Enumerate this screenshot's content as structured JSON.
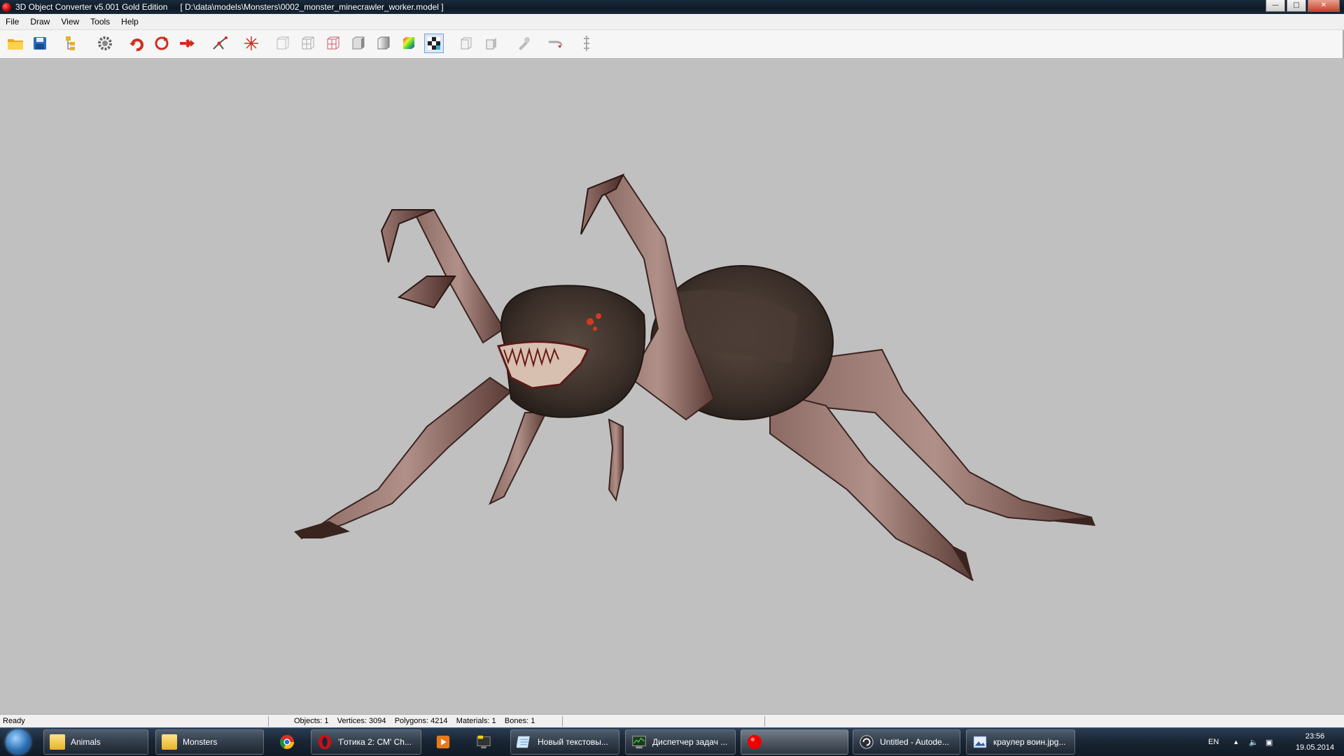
{
  "window": {
    "title": "3D Object Converter v5.001 Gold Edition",
    "path": "[ D:\\data\\models\\Monsters\\0002_monster_minecrawler_worker.model ]",
    "buttons": [
      "minimize",
      "maximize",
      "close"
    ]
  },
  "menu": [
    "File",
    "Draw",
    "View",
    "Tools",
    "Help"
  ],
  "toolbar": {
    "icons": [
      "open-folder-icon",
      "save-icon",
      "tree-icon",
      "settings-gear-icon",
      "rotate-left-icon",
      "rotate-icon",
      "move-icon",
      "skeleton-icon",
      "center-icon",
      "wireframe-icon",
      "wireframe-box-icon",
      "wireframe-red-icon",
      "flat-shade-icon",
      "smooth-shade-icon",
      "color-shade-icon",
      "texture-checker-icon",
      "normals-icon",
      "box-icon",
      "tool-icon",
      "paint-icon",
      "bones-icon"
    ],
    "active": "texture-checker-icon"
  },
  "viewport": {
    "model": "minecrawler worker",
    "background": "#c0c0c0"
  },
  "status": {
    "ready": "Ready",
    "objects": "Objects: 1",
    "vertices": "Vertices: 3094",
    "polygons": "Polygons: 4214",
    "materials": "Materials: 1",
    "bones": "Bones: 1"
  },
  "taskbar": {
    "tasks": [
      {
        "label": "Animals",
        "icon": "folder-icon"
      },
      {
        "label": "Monsters",
        "icon": "folder-icon"
      },
      {
        "label": "",
        "icon": "chrome-icon"
      },
      {
        "label": "'Готика 2: СМ' Ch...",
        "icon": "opera-icon"
      },
      {
        "label": "",
        "icon": "media-player-icon"
      },
      {
        "label": "",
        "icon": "monitor-icon"
      },
      {
        "label": "Новый текстовы...",
        "icon": "notepad-icon"
      },
      {
        "label": "Диспетчер задач ...",
        "icon": "task-manager-icon"
      },
      {
        "label": "",
        "icon": "converter-app-icon"
      },
      {
        "label": "Untitled - Autode...",
        "icon": "autodesk-icon"
      },
      {
        "label": "краулер воин.jpg...",
        "icon": "image-viewer-icon"
      }
    ],
    "language": "EN",
    "time": "23:56",
    "date": "19.05.2014"
  }
}
